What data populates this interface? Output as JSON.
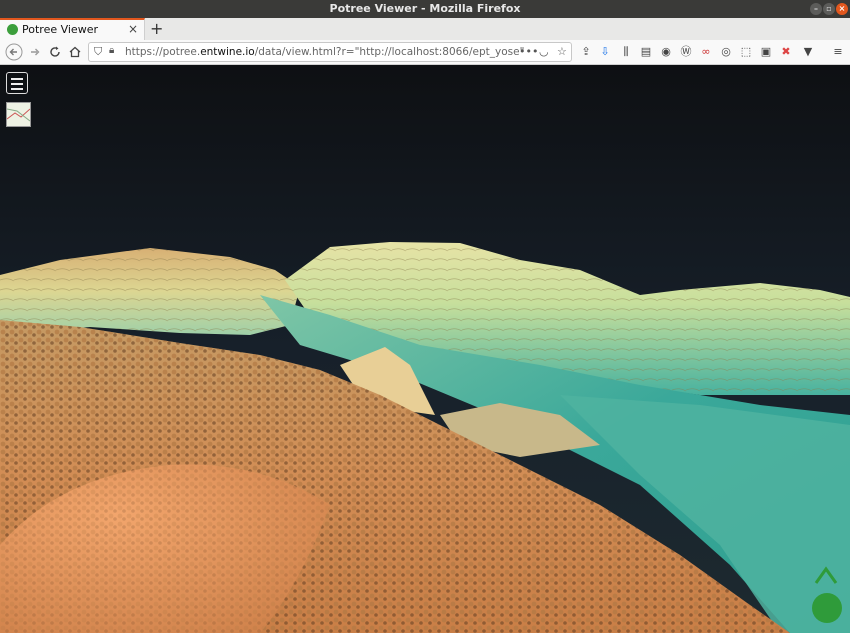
{
  "window": {
    "title": "Potree Viewer - Mozilla Firefox"
  },
  "tabs": [
    {
      "label": "Potree Viewer"
    }
  ],
  "address_bar": {
    "url_prefix": "https://potree.",
    "url_domain": "entwine.io",
    "url_rest": "/data/view.html?r=\"http://localhost:8066/ept_yose\""
  },
  "icons": {
    "back": "arrow-left-icon",
    "forward": "arrow-right-icon",
    "reload": "reload-icon",
    "home": "home-icon",
    "menu": "hamburger-menu-icon",
    "compass": "navigation-cube-icon"
  },
  "colors": {
    "sky_top": "#0e1013",
    "sky_bottom": "#1d2a30",
    "terrain_high": "#d9a060",
    "terrain_mid": "#e0e08a",
    "terrain_low": "#3aa89a",
    "compass": "#2f9b3a"
  }
}
